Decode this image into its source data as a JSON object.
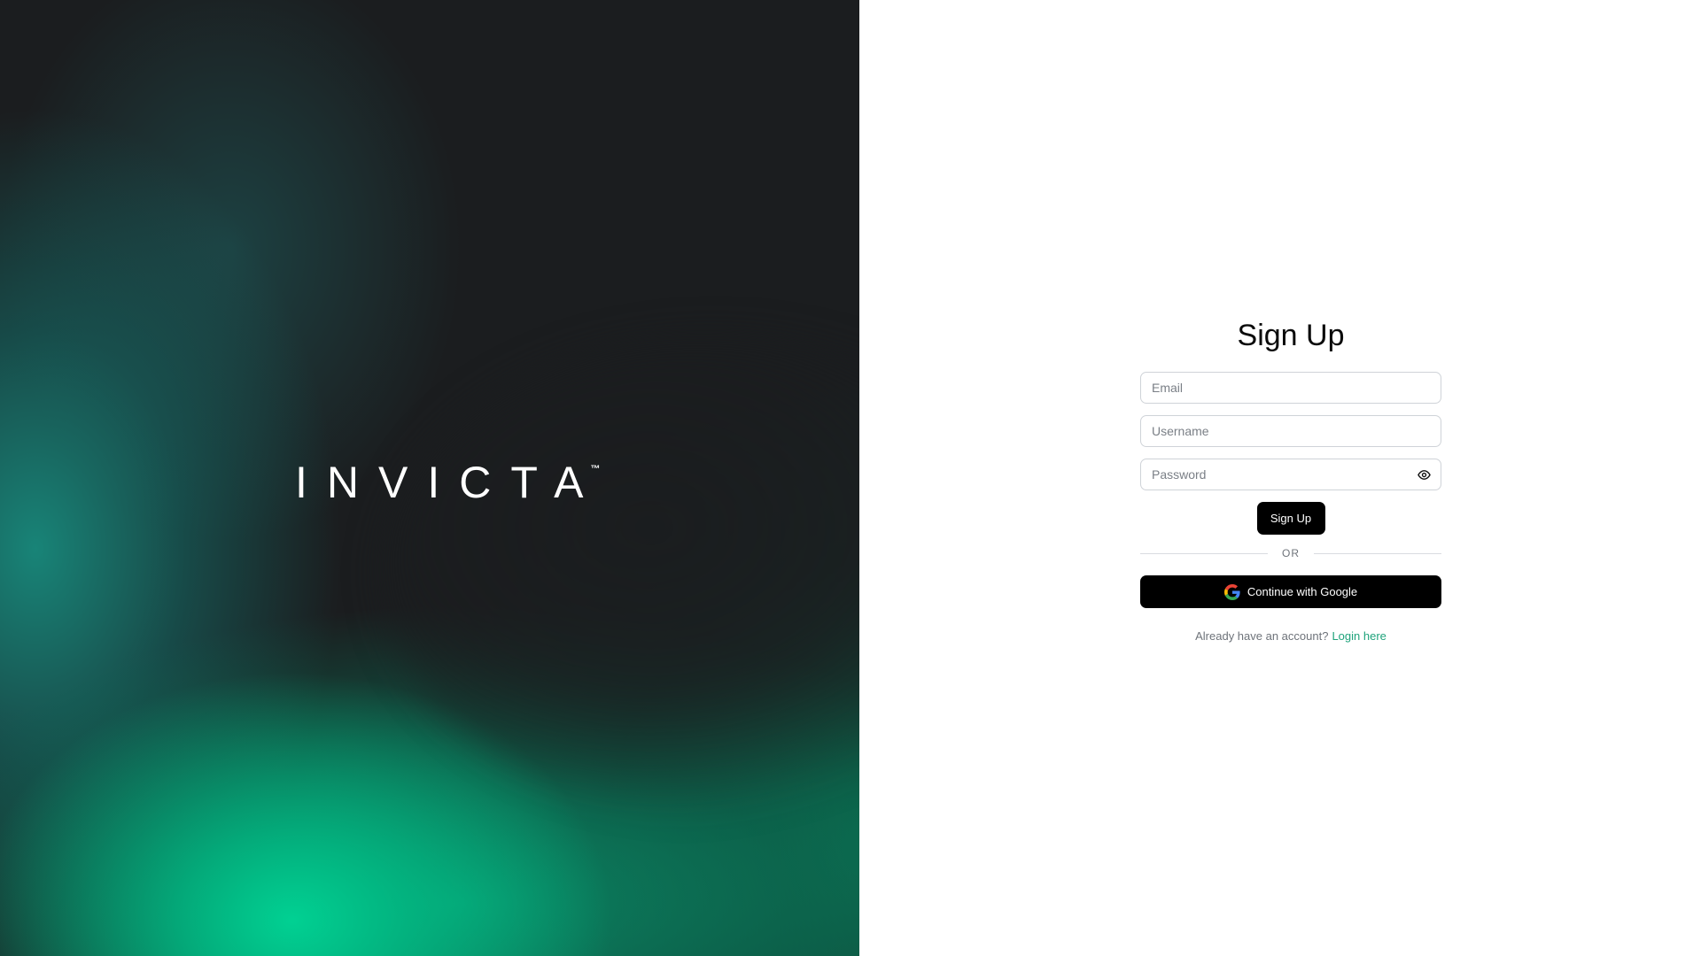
{
  "brand": {
    "name": "INVICTA",
    "trademark": "™"
  },
  "form": {
    "title": "Sign Up",
    "email_placeholder": "Email",
    "username_placeholder": "Username",
    "password_placeholder": "Password",
    "password_toggle_icon": "eye-icon",
    "signup_label": "Sign Up",
    "divider_label": "OR",
    "google_label": "Continue with Google",
    "google_icon": "google-icon",
    "footer_text": "Already have an account?",
    "login_link": "Login here"
  },
  "colors": {
    "hero_dark": "#1b1d1f",
    "hero_green": "#00c98f",
    "button_black": "#000000",
    "link_green": "#1fa37b"
  }
}
